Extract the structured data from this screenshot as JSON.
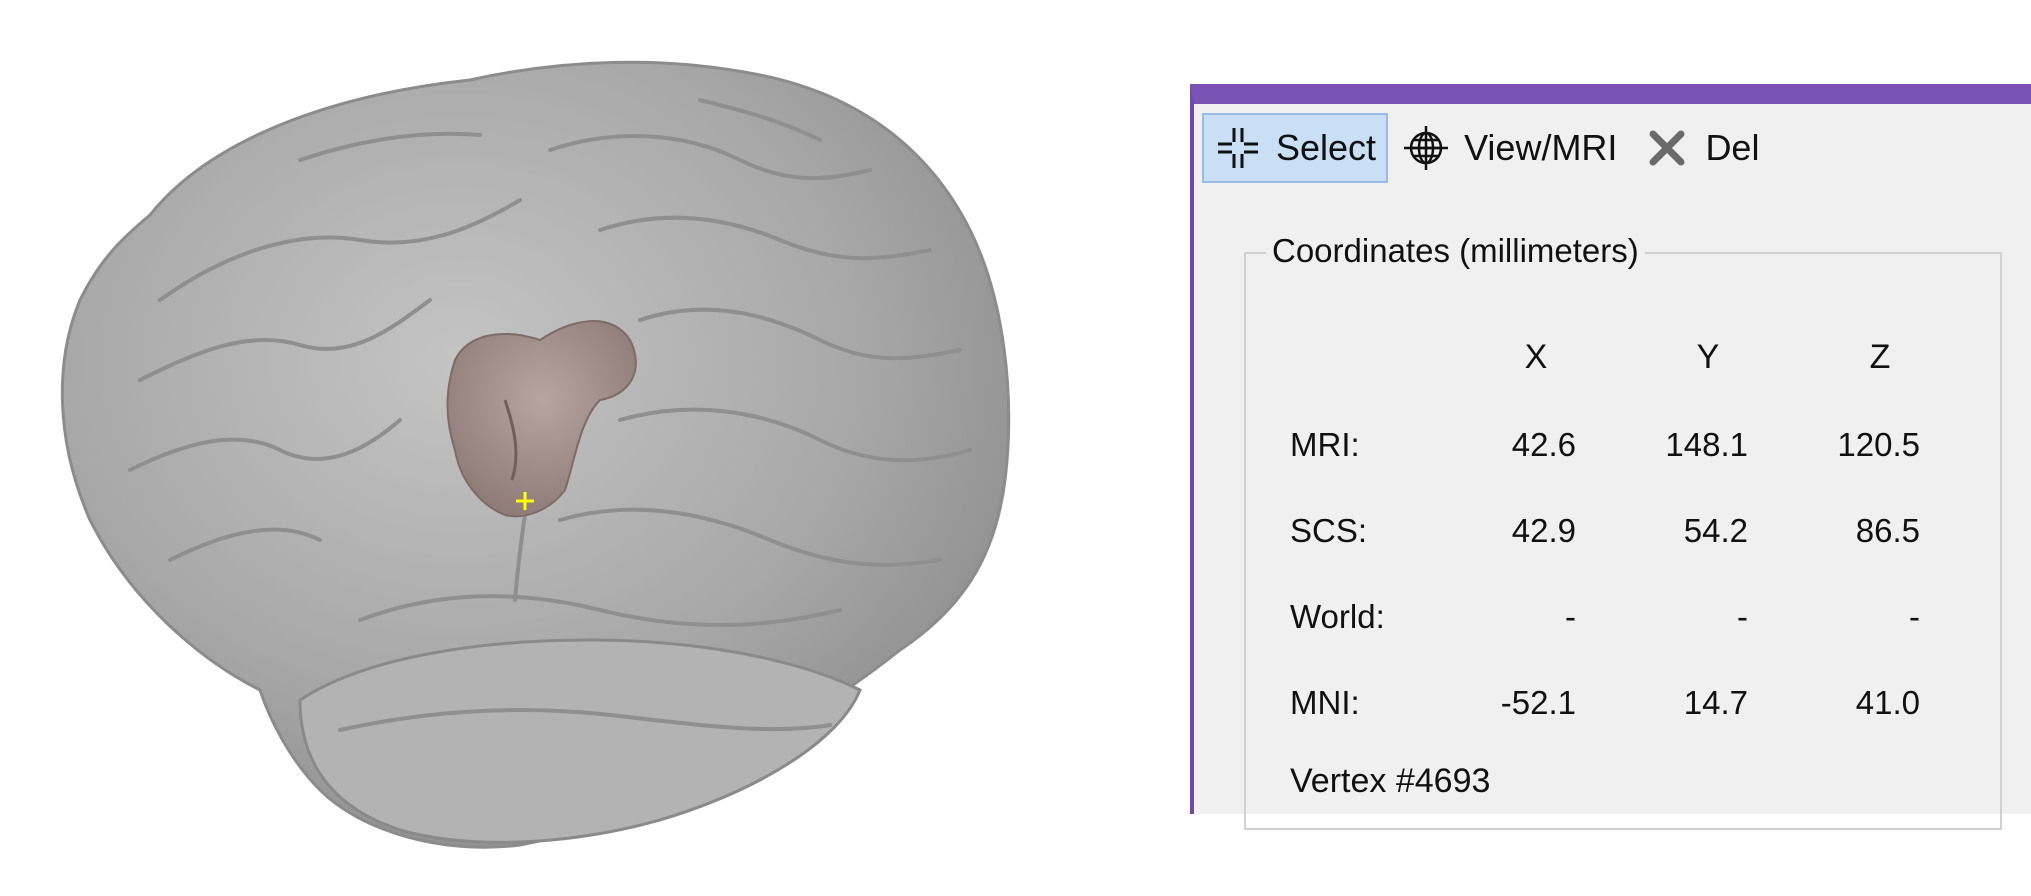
{
  "toolbar": {
    "select_label": "Select",
    "view_mri_label": "View/MRI",
    "delete_label": "Del",
    "icons": [
      "crosshair-icon",
      "globe-icon",
      "close-icon"
    ]
  },
  "coordinates": {
    "title": "Coordinates (millimeters)",
    "headers": [
      "X",
      "Y",
      "Z"
    ],
    "rows": [
      {
        "label": "MRI:",
        "x": "42.6",
        "y": "148.1",
        "z": "120.5"
      },
      {
        "label": "SCS:",
        "x": "42.9",
        "y": "54.2",
        "z": "86.5"
      },
      {
        "label": "World:",
        "x": "-",
        "y": "-",
        "z": "-"
      },
      {
        "label": "MNI:",
        "x": "-52.1",
        "y": "14.7",
        "z": "41.0"
      }
    ],
    "vertex": "Vertex #4693"
  },
  "colors": {
    "panel_accent": "#7a52b3",
    "brain_surface": "#a6a6a6",
    "scout_region": "#a28f8b",
    "cursor_marker": "#ffff00"
  }
}
